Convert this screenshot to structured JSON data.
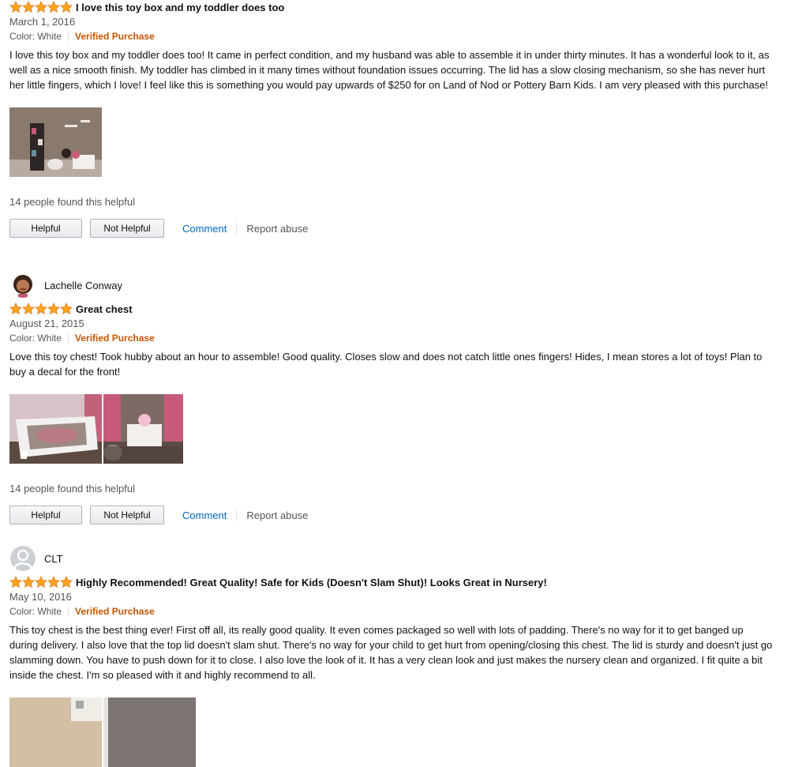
{
  "reviews": [
    {
      "author": "",
      "rating": 5,
      "title": "I love this toy box and my toddler does too",
      "date": "March 1, 2016",
      "color": "Color: White",
      "verified": "Verified Purchase",
      "body": "I love this toy box and my toddler does too! It came in perfect condition, and my husband was able to assemble it in under thirty minutes. It has a wonderful look to it, as well as a nice smooth finish. My toddler has climbed in it many times without foundation issues occurring. The lid has a slow closing mechanism, so she has never hurt her little fingers, which I love! I feel like this is something you would pay upwards of $250 for on Land of Nod or Pottery Barn Kids. I am very pleased with this purchase!",
      "helpful_count": "14 people found this helpful"
    },
    {
      "author": "Lachelle Conway",
      "rating": 5,
      "title": "Great chest",
      "date": "August 21, 2015",
      "color": "Color: White",
      "verified": "Verified Purchase",
      "body": "Love this toy chest! Took hubby about an hour to assemble! Good quality. Closes slow and does not catch little ones fingers! Hides, I mean stores a lot of toys! Plan to buy a decal for the front!",
      "helpful_count": "14 people found this helpful"
    },
    {
      "author": "CLT",
      "rating": 5,
      "title": "Highly Recommended! Great Quality! Safe for Kids (Doesn't Slam Shut)! Looks Great in Nursery!",
      "date": "May 10, 2016",
      "color": "Color: White",
      "verified": "Verified Purchase",
      "body": "This toy chest is the best thing ever! First off all, its really good quality. It even comes packaged so well with lots of padding. There's no way for it to get banged up during delivery. I also love that the top lid doesn't slam shut. There's no way for your child to get hurt from opening/closing this chest. The lid is sturdy and doesn't just go slamming down. You have to push down for it to close. I also love the look of it. It has a very clean look and just makes the nursery clean and organized. I fit quite a bit inside the chest. I'm so pleased with it and highly recommend to all."
    }
  ],
  "buttons": {
    "helpful": "Helpful",
    "not_helpful": "Not Helpful",
    "comment": "Comment",
    "report": "Report abuse"
  },
  "colors": {
    "star": "#ffa41c",
    "verified": "#c45500",
    "link": "#0066c0"
  }
}
